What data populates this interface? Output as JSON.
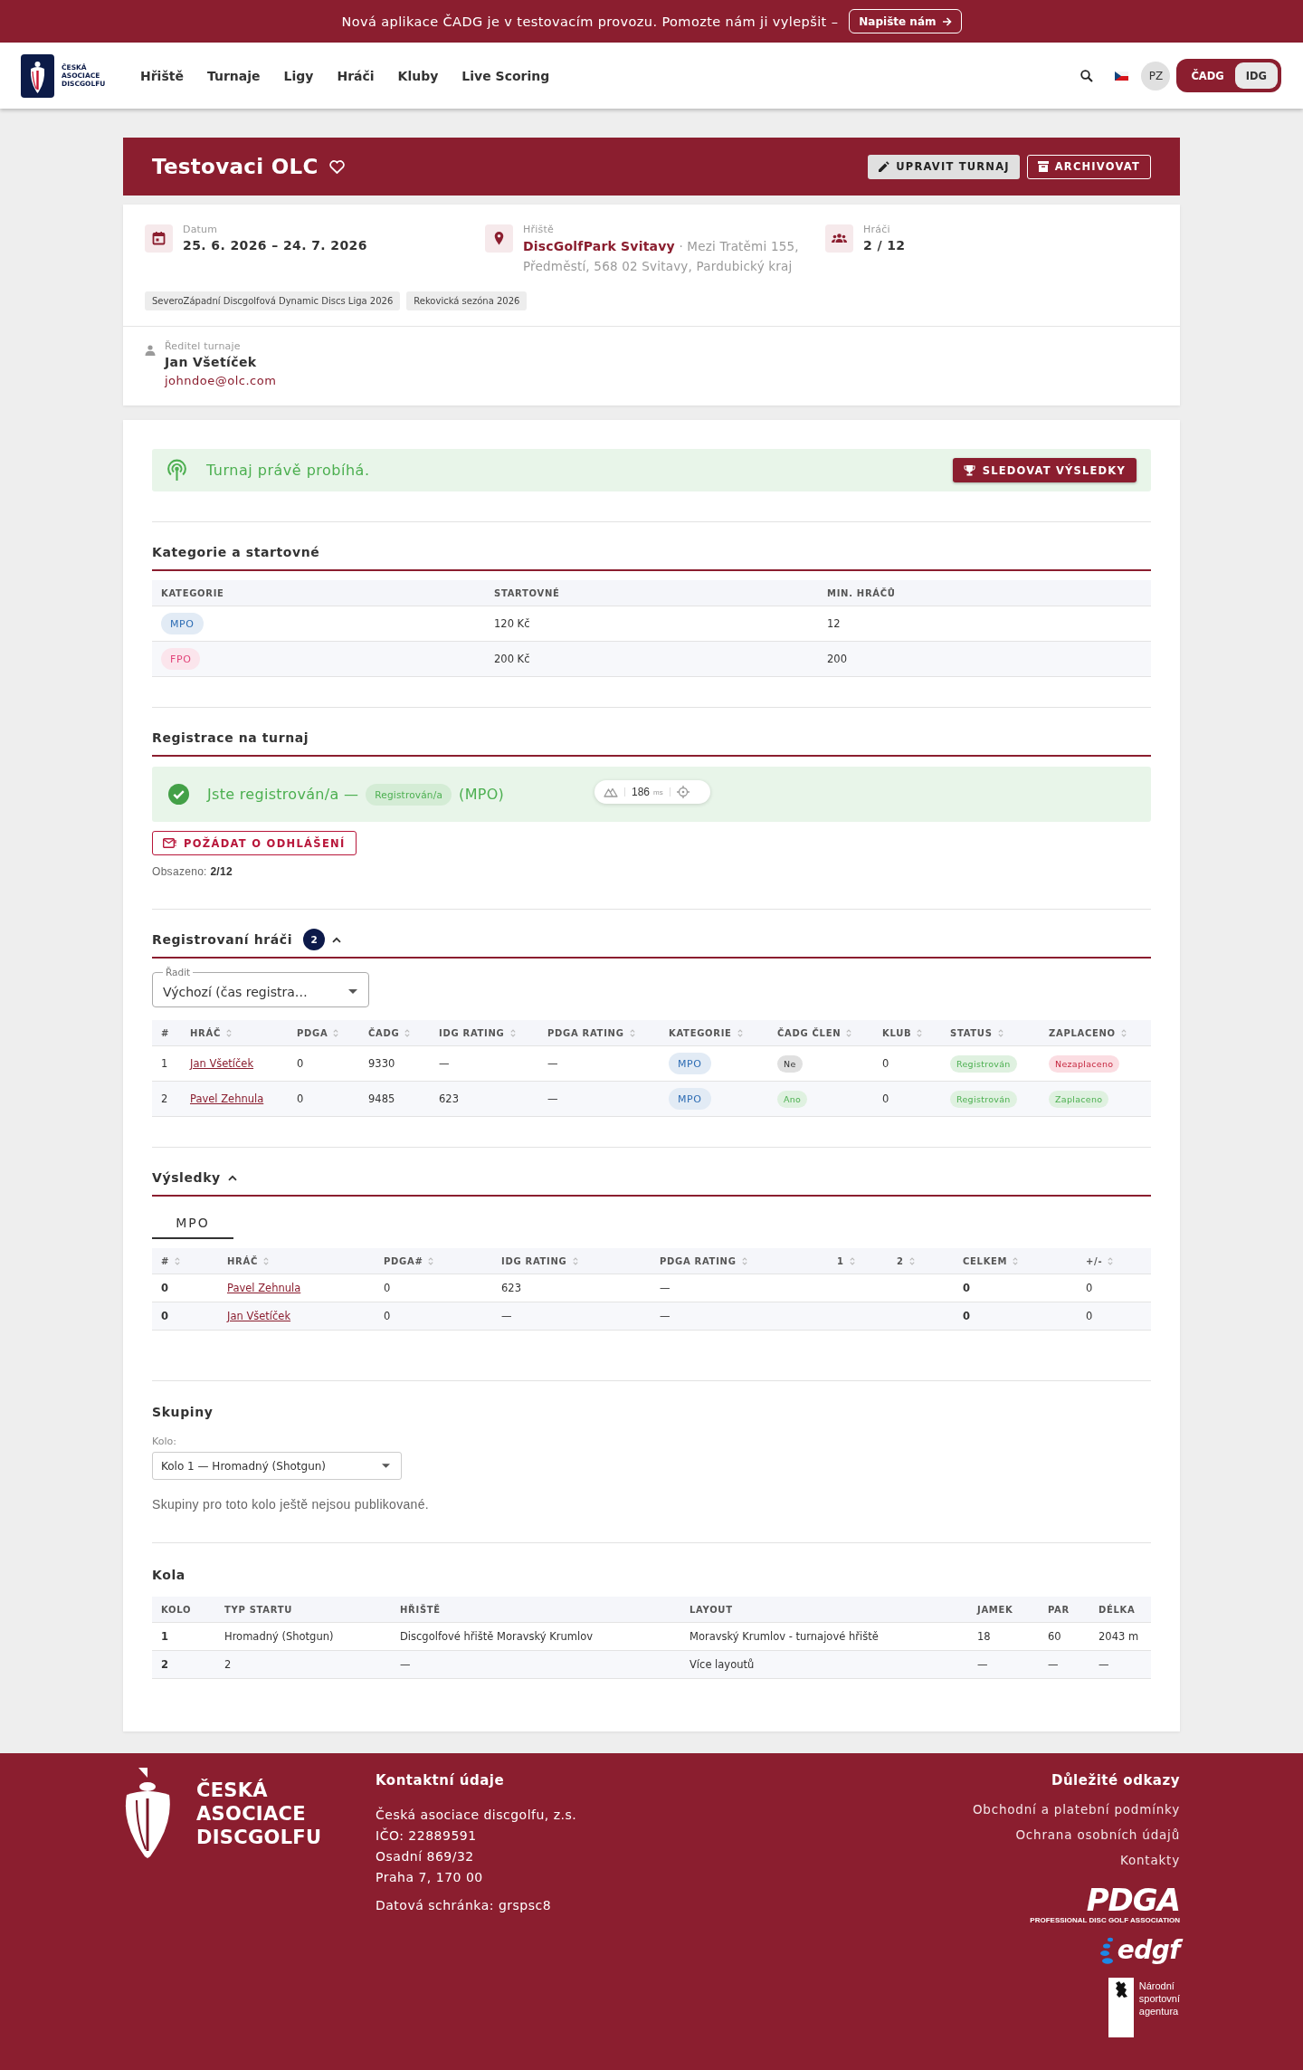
{
  "banner": {
    "text": "Nová aplikace ČADG je v testovacím provozu. Pomozte nám ji vylepšit –",
    "button": "Napište nám"
  },
  "nav": {
    "logo_text": "ČESKÁ ASOCIACE DISCGOLFU",
    "items": [
      "Hřiště",
      "Turnaje",
      "Ligy",
      "Hráči",
      "Kluby",
      "Live Scoring"
    ],
    "avatar": "PZ",
    "federations": [
      {
        "label": "ČADG",
        "selected": false
      },
      {
        "label": "IDG",
        "selected": true
      }
    ]
  },
  "tournament": {
    "title": "Testovaci OLC",
    "favorite": false,
    "actions": [
      {
        "label": "UPRAVIT TURNAJ",
        "kind": "edit"
      },
      {
        "label": "ARCHIVOVAT",
        "kind": "archive"
      }
    ]
  },
  "details": {
    "date": {
      "label": "Datum",
      "value": "25. 6. 2026 – 24. 7. 2026"
    },
    "course": {
      "label": "Hřiště",
      "name": "DiscGolfPark Svitavy",
      "address": "· Mezi Tratěmi 155, Předměstí, 568 02 Svitavy, Pardubický kraj"
    },
    "players": {
      "label": "Hráči",
      "value": "2 / 12"
    },
    "leagues": [
      "SeveroZápadní Discgolfová Dynamic Discs Liga 2026",
      "Rekovická sezóna 2026"
    ],
    "director": {
      "label": "Ředitel turnaje",
      "name": "Jan Všetíček",
      "email": "johndoe@olc.com"
    }
  },
  "live": {
    "text": "Turnaj právě probíhá.",
    "button": "SLEDOVAT VÝSLEDKY"
  },
  "categories": {
    "title": "Kategorie a startovné",
    "columns": [
      "KATEGORIE",
      "STARTOVNÉ",
      "MIN. HRÁČŮ"
    ],
    "rows": [
      {
        "category": "MPO",
        "color": "#2e6db4",
        "fee": "120 Kč",
        "min_players": "12"
      },
      {
        "category": "FPO",
        "color": "#e2457a",
        "fee": "200 Kč",
        "min_players": "200"
      }
    ]
  },
  "registration": {
    "title": "Registrace na turnaj",
    "message": "Jste registrován/a —",
    "status": "Registrován/a",
    "category": "(MPO)",
    "button": "POŽÁDAT O ODHLÁŠENÍ",
    "occupancy": "Obsazeno: **2/12**"
  },
  "devtools_badge": {
    "value": "186",
    "unit": "ms"
  },
  "registered_players": {
    "title": "Registrovaní hráči",
    "count": "2",
    "expanded": true,
    "sort": {
      "label": "Řadit",
      "value": "Výchozí (čas registra…"
    },
    "columns": [
      {
        "label": "#",
        "sortable": false
      },
      {
        "label": "HRÁČ",
        "sortable": true
      },
      {
        "label": "PDGA",
        "sortable": true
      },
      {
        "label": "ČADG",
        "sortable": true
      },
      {
        "label": "IDG RATING",
        "sortable": true
      },
      {
        "label": "PDGA RATING",
        "sortable": true
      },
      {
        "label": "KATEGORIE",
        "sortable": true
      },
      {
        "label": "ČADG ČLEN",
        "sortable": true
      },
      {
        "label": "KLUB",
        "sortable": true
      },
      {
        "label": "STATUS",
        "sortable": true
      },
      {
        "label": "ZAPLACENO",
        "sortable": true
      }
    ],
    "rows": [
      {
        "number": "1",
        "name": "Jan Všetíček",
        "pdga": "0",
        "cadg": "9330",
        "idg_rating": "—",
        "pdga_rating": "—",
        "category": "MPO",
        "color": "#2e6db4",
        "member": {
          "label": "Ne",
          "value": false
        },
        "club": "0",
        "status": "Registrován",
        "paid": {
          "label": "Nezaplaceno",
          "value": false
        }
      },
      {
        "number": "2",
        "name": "Pavel Zehnula",
        "pdga": "0",
        "cadg": "9485",
        "idg_rating": "623",
        "pdga_rating": "—",
        "category": "MPO",
        "color": "#2e6db4",
        "member": {
          "label": "Ano",
          "value": true
        },
        "club": "0",
        "status": "Registrován",
        "paid": {
          "label": "Zaplaceno",
          "value": true
        }
      }
    ]
  },
  "results": {
    "title": "Výsledky",
    "expanded": true,
    "tabs": [
      {
        "label": "MPO",
        "selected": true
      }
    ],
    "columns": [
      {
        "label": "#",
        "sortable": true
      },
      {
        "label": "HRÁČ",
        "sortable": true
      },
      {
        "label": "PDGA#",
        "sortable": true
      },
      {
        "label": "IDG RATING",
        "sortable": true
      },
      {
        "label": "PDGA RATING",
        "sortable": true
      },
      {
        "label": "1",
        "sortable": true
      },
      {
        "label": "2",
        "sortable": true
      },
      {
        "label": "CELKEM",
        "sortable": true
      },
      {
        "label": "+/-",
        "sortable": true
      }
    ],
    "rows": [
      {
        "rank": "0",
        "name": "Pavel Zehnula",
        "pdga": "0",
        "idg_rating": "623",
        "pdga_rating": "—",
        "total": "0",
        "diff": "0"
      },
      {
        "rank": "0",
        "name": "Jan Všetíček",
        "pdga": "0",
        "idg_rating": "—",
        "pdga_rating": "—",
        "total": "0",
        "diff": "0"
      }
    ]
  },
  "groups": {
    "title": "Skupiny",
    "round": {
      "label": "Kolo:",
      "value": "Kolo 1 — Hromadný (Shotgun)"
    },
    "note": "Skupiny pro toto kolo ještě nejsou publikované."
  },
  "rounds": {
    "title": "Kola",
    "columns": [
      "KOLO",
      "TYP STARTU",
      "HŘIŠTĚ",
      "LAYOUT",
      "JAMEK",
      "PAR",
      "DÉLKA"
    ],
    "rows": [
      [
        "1",
        "Hromadný (Shotgun)",
        "Discgolfové hřiště Moravský Krumlov",
        "Moravský Krumlov - turnajové hřiště",
        "18",
        "60",
        "2043 m"
      ],
      [
        "2",
        "2",
        "—",
        "Více layoutů",
        "—",
        "—",
        "—"
      ]
    ]
  },
  "footer": {
    "logo_text": "ČESKÁ ASOCIACE DISCGOLFU",
    "contact": {
      "title": "Kontaktní údaje",
      "lines": [
        "Česká asociace discgolfu, z.s.",
        "IČO: 22889591",
        "Osadní 869/32",
        "Praha 7, 170 00"
      ],
      "databox": "Datová schránka: grspsc8"
    },
    "links": {
      "title": "Důležité odkazy",
      "items": [
        "Obchodní a platební podmínky",
        "Ochrana osobních údajů",
        "Kontakty"
      ]
    },
    "partners": [
      {
        "kind": "pdga",
        "name": "PDGA",
        "tagline": "PROFESSIONAL DISC GOLF ASSOCIATION"
      },
      {
        "kind": "edgf",
        "name": "edgf"
      },
      {
        "kind": "nsa",
        "name": "Národní sportovní agentura"
      }
    ]
  }
}
